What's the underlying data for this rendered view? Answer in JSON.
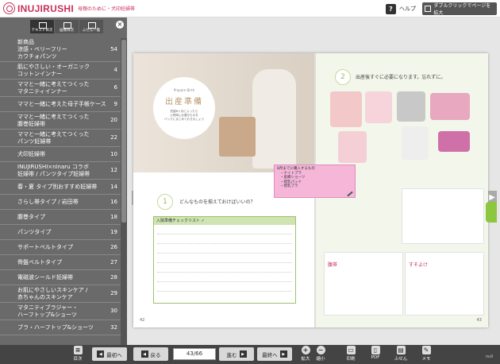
{
  "header": {
    "brand": "INUJIRUSHI",
    "tagline": "母親のために・犬印妊婦帯",
    "help_label": "ヘルプ",
    "help_icon": "?",
    "dblclick_label": "ダブルクリックでページを拡大"
  },
  "sidebar": {
    "tabs": [
      {
        "label": "テキスト目次"
      },
      {
        "label": "画像目次"
      },
      {
        "label": "ふせん一覧"
      }
    ],
    "close_icon": "×",
    "items": [
      {
        "label": "新商品\n涼感・ベリーフリー\nカウチォパンツ",
        "page": "54"
      },
      {
        "label": "肌にやさしい・オーガニック\nコットンインナー",
        "page": "4"
      },
      {
        "label": "ママと一緒に考えてつくった\nマタニティインナー",
        "page": "6"
      },
      {
        "label": "ママと一緒に考えた母子手帳ケース",
        "page": "9"
      },
      {
        "label": "ママと一緒に考えてつくった\n腹巻妊婦帯",
        "page": "20"
      },
      {
        "label": "ママと一緒に考えてつくった\nパンツ妊婦帯",
        "page": "22"
      },
      {
        "label": "犬印妊婦帯",
        "page": "10"
      },
      {
        "label": "INUJIRUSHI×ninaru コラボ\n妊婦帯 / パンツタイプ妊婦帯",
        "page": "12"
      },
      {
        "label": "春・夏 タイプ別おすすめ妊婦帯",
        "page": "14"
      },
      {
        "label": "さらし帯タイプ / 岩田帯",
        "page": "16"
      },
      {
        "label": "腹巻タイプ",
        "page": "18"
      },
      {
        "label": "パンツタイプ",
        "page": "19"
      },
      {
        "label": "サポートベルトタイプ",
        "page": "26"
      },
      {
        "label": "骨盤ベルトタイプ",
        "page": "27"
      },
      {
        "label": "電磁波シールド妊婦帯",
        "page": "28"
      },
      {
        "label": "お肌にやさしいスキンケア /\n赤ちゃんのスキンケア",
        "page": "29"
      },
      {
        "label": "マタニティブラジャー・\nハーフトップ&ショーツ",
        "page": "30"
      },
      {
        "label": "ブラ・ハーフトップ&ショーツ",
        "page": "32"
      }
    ]
  },
  "book": {
    "left_page": {
      "circle_en": "Prepare Birth",
      "circle_title": "出産準備",
      "circle_desc": "妊娠8ヶ月に入ったら\n入院時に必要なものを\nバッグにまとめておきましょう",
      "q_number": "1",
      "q_text": "どんなものを揃えておけばいいの？",
      "checklist_title": "入院準備チェックリスト ✓",
      "page_number": "42"
    },
    "right_page": {
      "q_number": "2",
      "q_text": "出産後すぐに必要になります。忘れずに。",
      "product1": "腹帯",
      "product2": "すそよけ",
      "page_number": "43"
    },
    "note": {
      "title": "8月までに購入するもの",
      "items": [
        "・ナイトブラ",
        "・産褥ショーツ",
        "・授乳パッド",
        "・授乳ブラ"
      ]
    },
    "prev_arrow": "◀",
    "next_arrow": "▶"
  },
  "bottombar": {
    "toc_label": "目次",
    "first_label": "最初へ",
    "back_label": "戻る",
    "page_value": "43/66",
    "forward_label": "進む",
    "last_label": "最終へ",
    "zoom_in_label": "拡大",
    "zoom_out_label": "縮小",
    "print_label": "印刷",
    "pdf_label": "PDF",
    "sticky_label": "ふせん",
    "memo_label": "メモ",
    "corner_text": "null"
  }
}
